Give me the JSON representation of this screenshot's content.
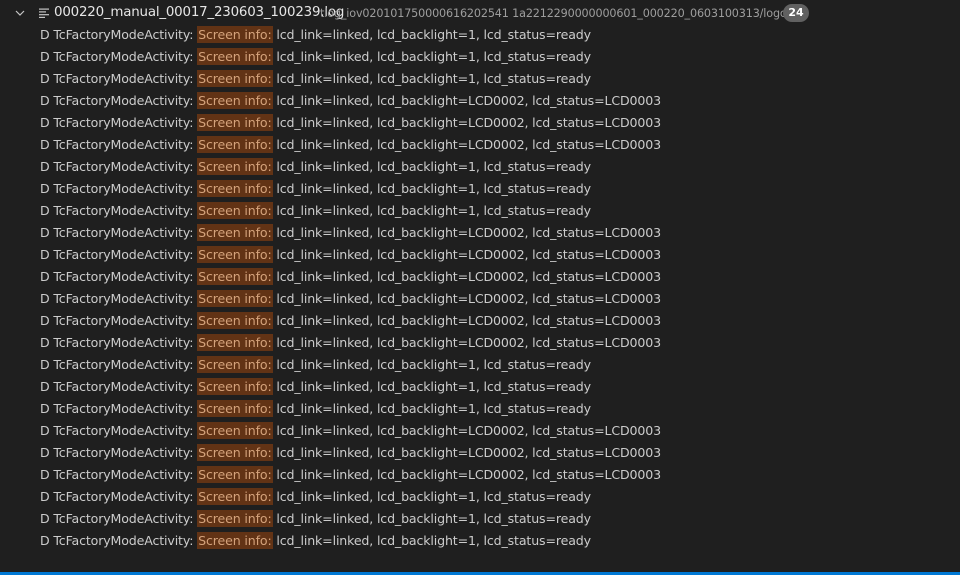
{
  "search_result_file": {
    "name": "000220_manual_00017_230603_100239.log",
    "path": "tlog_iov020101750000616202541 1a2212290000000601_000220_0603100313/logcat",
    "match_count": "24",
    "chevron_icon": "chevron-down-icon",
    "file_icon": "text-file-icon"
  },
  "matches": [
    {
      "prefix": "D TcFactoryModeActivity: ",
      "highlight": "Screen info:",
      "suffix": " lcd_link=linked, lcd_backlight=1, lcd_status=ready"
    },
    {
      "prefix": "D TcFactoryModeActivity: ",
      "highlight": "Screen info:",
      "suffix": " lcd_link=linked, lcd_backlight=1, lcd_status=ready"
    },
    {
      "prefix": "D TcFactoryModeActivity: ",
      "highlight": "Screen info:",
      "suffix": " lcd_link=linked, lcd_backlight=1, lcd_status=ready"
    },
    {
      "prefix": "D TcFactoryModeActivity: ",
      "highlight": "Screen info:",
      "suffix": " lcd_link=linked, lcd_backlight=LCD0002, lcd_status=LCD0003"
    },
    {
      "prefix": "D TcFactoryModeActivity: ",
      "highlight": "Screen info:",
      "suffix": " lcd_link=linked, lcd_backlight=LCD0002, lcd_status=LCD0003"
    },
    {
      "prefix": "D TcFactoryModeActivity: ",
      "highlight": "Screen info:",
      "suffix": " lcd_link=linked, lcd_backlight=LCD0002, lcd_status=LCD0003"
    },
    {
      "prefix": "D TcFactoryModeActivity: ",
      "highlight": "Screen info:",
      "suffix": " lcd_link=linked, lcd_backlight=1, lcd_status=ready"
    },
    {
      "prefix": "D TcFactoryModeActivity: ",
      "highlight": "Screen info:",
      "suffix": " lcd_link=linked, lcd_backlight=1, lcd_status=ready"
    },
    {
      "prefix": "D TcFactoryModeActivity: ",
      "highlight": "Screen info:",
      "suffix": " lcd_link=linked, lcd_backlight=1, lcd_status=ready"
    },
    {
      "prefix": "D TcFactoryModeActivity: ",
      "highlight": "Screen info:",
      "suffix": " lcd_link=linked, lcd_backlight=LCD0002, lcd_status=LCD0003"
    },
    {
      "prefix": "D TcFactoryModeActivity: ",
      "highlight": "Screen info:",
      "suffix": " lcd_link=linked, lcd_backlight=LCD0002, lcd_status=LCD0003"
    },
    {
      "prefix": "D TcFactoryModeActivity: ",
      "highlight": "Screen info:",
      "suffix": " lcd_link=linked, lcd_backlight=LCD0002, lcd_status=LCD0003"
    },
    {
      "prefix": "D TcFactoryModeActivity: ",
      "highlight": "Screen info:",
      "suffix": " lcd_link=linked, lcd_backlight=LCD0002, lcd_status=LCD0003"
    },
    {
      "prefix": "D TcFactoryModeActivity: ",
      "highlight": "Screen info:",
      "suffix": " lcd_link=linked, lcd_backlight=LCD0002, lcd_status=LCD0003"
    },
    {
      "prefix": "D TcFactoryModeActivity: ",
      "highlight": "Screen info:",
      "suffix": " lcd_link=linked, lcd_backlight=LCD0002, lcd_status=LCD0003"
    },
    {
      "prefix": "D TcFactoryModeActivity: ",
      "highlight": "Screen info:",
      "suffix": " lcd_link=linked, lcd_backlight=1, lcd_status=ready"
    },
    {
      "prefix": "D TcFactoryModeActivity: ",
      "highlight": "Screen info:",
      "suffix": " lcd_link=linked, lcd_backlight=1, lcd_status=ready"
    },
    {
      "prefix": "D TcFactoryModeActivity: ",
      "highlight": "Screen info:",
      "suffix": " lcd_link=linked, lcd_backlight=1, lcd_status=ready"
    },
    {
      "prefix": "D TcFactoryModeActivity: ",
      "highlight": "Screen info:",
      "suffix": " lcd_link=linked, lcd_backlight=LCD0002, lcd_status=LCD0003"
    },
    {
      "prefix": "D TcFactoryModeActivity: ",
      "highlight": "Screen info:",
      "suffix": " lcd_link=linked, lcd_backlight=LCD0002, lcd_status=LCD0003"
    },
    {
      "prefix": "D TcFactoryModeActivity: ",
      "highlight": "Screen info:",
      "suffix": " lcd_link=linked, lcd_backlight=LCD0002, lcd_status=LCD0003"
    },
    {
      "prefix": "D TcFactoryModeActivity: ",
      "highlight": "Screen info:",
      "suffix": " lcd_link=linked, lcd_backlight=1, lcd_status=ready"
    },
    {
      "prefix": "D TcFactoryModeActivity: ",
      "highlight": "Screen info:",
      "suffix": " lcd_link=linked, lcd_backlight=1, lcd_status=ready"
    },
    {
      "prefix": "D TcFactoryModeActivity: ",
      "highlight": "Screen info:",
      "suffix": " lcd_link=linked, lcd_backlight=1, lcd_status=ready"
    }
  ],
  "colors": {
    "background": "#1f1f1f",
    "text": "#cccccc",
    "match_highlight_bg": "#623315",
    "match_highlight_text": "#d4a27b",
    "badge_bg": "#616161",
    "status_bar_accent": "#0078d4"
  }
}
